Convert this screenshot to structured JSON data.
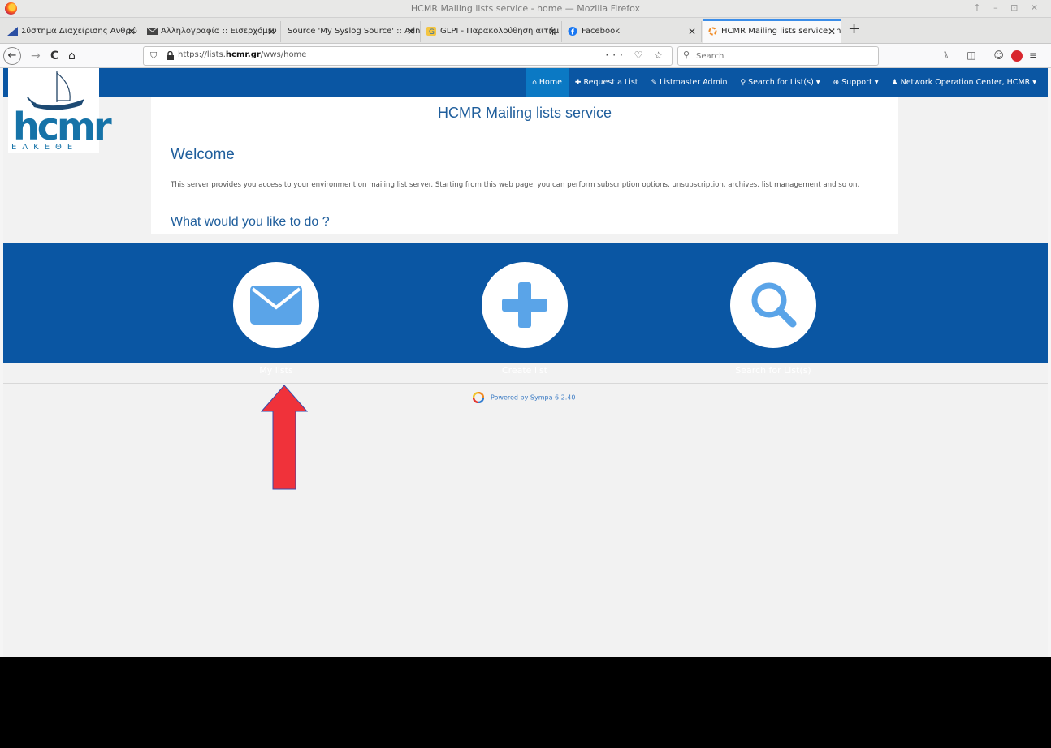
{
  "window": {
    "title": "HCMR Mailing lists service - home — Mozilla Firefox",
    "controls": "↑ – ⊡ ✕"
  },
  "tabs": [
    {
      "label": "Σύστημα Διαχείρισης Ανθρώ",
      "close": "✕"
    },
    {
      "label": "Αλληλογραφία :: Εισερχόμεν",
      "close": "✕"
    },
    {
      "label": "Source 'My Syslog Source' :: Adn",
      "close": "✕"
    },
    {
      "label": "GLPI - Παρακολούθηση αιτήμ",
      "close": "✕"
    },
    {
      "label": "Facebook",
      "close": "✕"
    },
    {
      "label": "HCMR Mailing lists service - h",
      "close": "✕"
    }
  ],
  "newtab": "+",
  "nav": {
    "back": "←",
    "forward": "→",
    "reload": "C",
    "home": "⌂",
    "url_prefix": "https://lists.",
    "url_host": "hcmr.gr",
    "url_path": "/wws/home",
    "url_actions": "··· ♡ ☆",
    "search_placeholder": "Search",
    "tools": "⑊ ◫ ☺"
  },
  "site": {
    "logo_text": "hcmr",
    "logo_sub": "ΕΛΚΕΘΕ",
    "menu": [
      {
        "icon": "⌂",
        "label": "Home"
      },
      {
        "icon": "✚",
        "label": "Request a List"
      },
      {
        "icon": "✎",
        "label": "Listmaster Admin"
      },
      {
        "icon": "⚲",
        "label": "Search for List(s)",
        "caret": "▾"
      },
      {
        "icon": "⊕",
        "label": "Support",
        "caret": "▾"
      },
      {
        "icon": "♟",
        "label": "Network Operation Center, HCMR",
        "caret": "▾"
      }
    ]
  },
  "main": {
    "title": "HCMR Mailing lists service",
    "welcome": "Welcome",
    "intro": "This server provides you access to your environment on mailing list server. Starting from this web page, you can perform subscription options, unsubscription, archives, list management and so on.",
    "question": "What would you like to do ?"
  },
  "actions": [
    {
      "label": "My lists",
      "icon": "envelope-icon"
    },
    {
      "label": "Create list",
      "icon": "plus-icon"
    },
    {
      "label": "Search for List(s)",
      "icon": "magnifier-icon"
    }
  ],
  "footer": {
    "powered": "Powered by Sympa 6.2.40"
  },
  "colors": {
    "nav_blue": "#0a56a3",
    "active_tab": "#0b79c4",
    "icon_blue": "#5aa4e8",
    "arrow_red": "#f0323a"
  }
}
